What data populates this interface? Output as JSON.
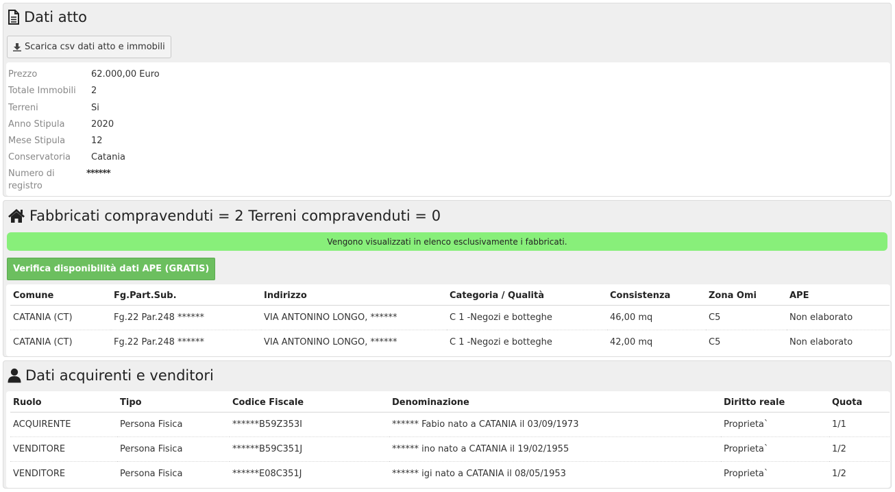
{
  "atto": {
    "title": "Dati atto",
    "download_label": "Scarica csv dati atto e immobili",
    "fields": [
      {
        "label": "Prezzo",
        "value": "62.000,00 Euro"
      },
      {
        "label": "Totale Immobili",
        "value": "2"
      },
      {
        "label": "Terreni",
        "value": "Si"
      },
      {
        "label": "Anno Stipula",
        "value": "2020"
      },
      {
        "label": "Mese Stipula",
        "value": "12"
      },
      {
        "label": "Conservatoria",
        "value": "Catania"
      },
      {
        "label": "Numero di registro",
        "value": "******"
      }
    ]
  },
  "fabbricati": {
    "title": "Fabbricati compravenduti = 2 Terreni compravenduti = 0",
    "notice": "Vengono visualizzati in elenco esclusivamente i fabbricati.",
    "ape_button": "Verifica disponibilità dati APE (GRATIS)",
    "columns": [
      "Comune",
      "Fg.Part.Sub.",
      "Indirizzo",
      "Categoria / Qualità",
      "Consistenza",
      "Zona Omi",
      "APE"
    ],
    "rows": [
      [
        "CATANIA (CT)",
        "Fg.22 Par.248 ******",
        "VIA ANTONINO LONGO, ******",
        "C 1 -Negozi e botteghe",
        "46,00 mq",
        "C5",
        "Non elaborato"
      ],
      [
        "CATANIA (CT)",
        "Fg.22 Par.248 ******",
        "VIA ANTONINO LONGO, ******",
        "C 1 -Negozi e botteghe",
        "42,00 mq",
        "C5",
        "Non elaborato"
      ]
    ]
  },
  "soggetti": {
    "title": "Dati acquirenti e venditori",
    "columns": [
      "Ruolo",
      "Tipo",
      "Codice Fiscale",
      "Denominazione",
      "Diritto reale",
      "Quota"
    ],
    "rows": [
      [
        "ACQUIRENTE",
        "Persona Fisica",
        "******B59Z353I",
        "****** Fabio nato a CATANIA il 03/09/1973",
        "Proprieta`",
        "1/1"
      ],
      [
        "VENDITORE",
        "Persona Fisica",
        "******B59C351J",
        "****** ino nato a CATANIA il 19/02/1955",
        "Proprieta`",
        "1/2"
      ],
      [
        "VENDITORE",
        "Persona Fisica",
        "******E08C351J",
        "****** igi nato a CATANIA il 08/05/1953",
        "Proprieta`",
        "1/2"
      ]
    ]
  },
  "colors": {
    "notice_bg": "#88ef7a",
    "ape_button_bg": "#6cbf5f"
  },
  "icons": {
    "atto": "document-icon",
    "download": "download-icon",
    "fabbricati": "home-icon",
    "soggetti": "user-icon"
  }
}
